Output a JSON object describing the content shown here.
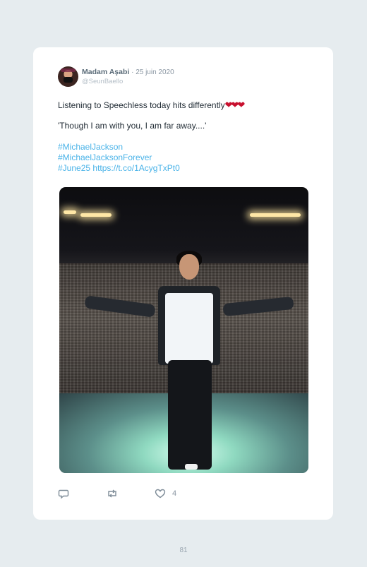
{
  "tweet": {
    "author_name": "Madam Aşabi",
    "separator": " · ",
    "date": "25 juin 2020",
    "handle": "@SeunBaello",
    "line1": "Listening to Speechless today hits differently",
    "line1_emoji": "❤❤❤",
    "line2": "'Though I am with you, I am far away....'",
    "hashtag1": "#MichaelJackson",
    "hashtag2": "#MichaelJacksonForever",
    "hashtag3": "#June25",
    "link": "https://t.co/1AcygTxPt0",
    "like_count": "4"
  },
  "icons": {
    "reply": "reply-icon",
    "retweet": "retweet-icon",
    "like": "heart-icon"
  },
  "colors": {
    "link": "#4ab3e8",
    "emoji": "#c8102e",
    "page_background": "#e6ecef",
    "card_background": "#ffffff"
  },
  "page": {
    "number": "81"
  }
}
